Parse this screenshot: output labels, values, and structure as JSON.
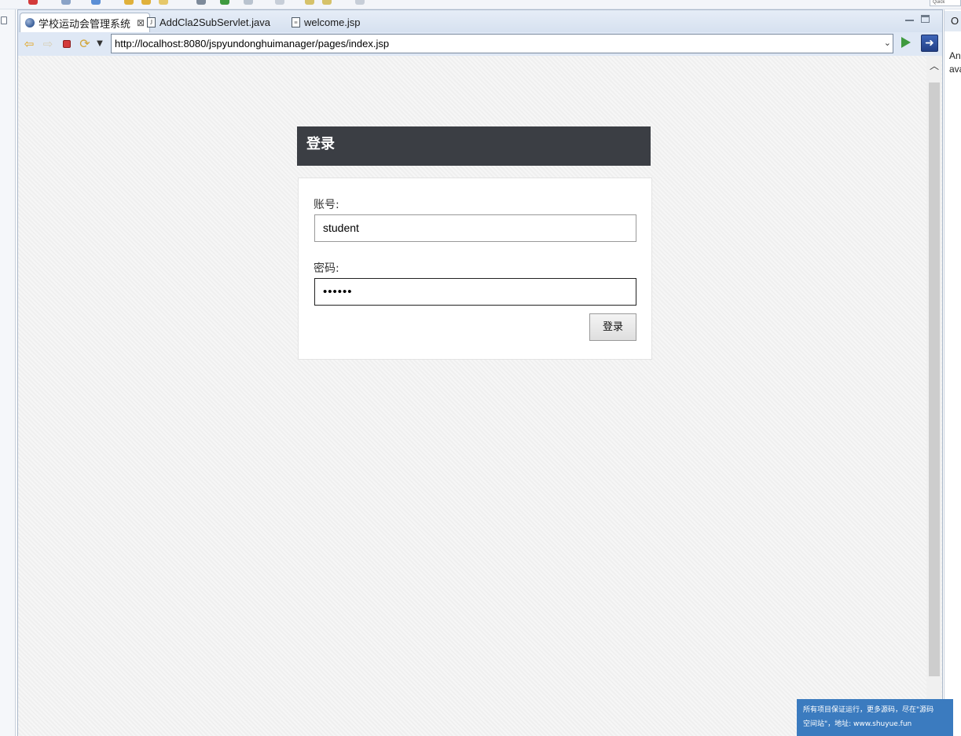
{
  "top_toolbar": {
    "quick_access_text": "Quick"
  },
  "tabs": [
    {
      "label": "学校运动会管理系统",
      "icon": "globe-icon",
      "active": true,
      "close": "⊠"
    },
    {
      "label": "AddCla2SubServlet.java",
      "icon": "java-file-icon",
      "active": false
    },
    {
      "label": "welcome.jsp",
      "icon": "jsp-file-icon",
      "active": false
    }
  ],
  "browser": {
    "url": "http://localhost:8080/jspyundonghuimanager/pages/index.jsp",
    "icons": {
      "back": "back-arrow-icon",
      "forward": "forward-arrow-icon",
      "stop": "stop-icon",
      "refresh": "refresh-icon",
      "go": "go-icon",
      "external": "open-external-icon"
    }
  },
  "login": {
    "title": "登录",
    "username_label": "账号:",
    "username_value": "student",
    "password_label": "密码:",
    "password_value": "••••••",
    "submit_label": "登录"
  },
  "watermark": {
    "line1": "所有项目保证运行，更多源码，尽在\"源码",
    "line2": "空间站\"，地址: www.shuyue.fun"
  },
  "right_panel": {
    "tab_label": "O",
    "text_line1": "An",
    "text_line2": "ava"
  },
  "colors": {
    "login_header_bg": "#3b3e44",
    "page_bg": "#f2f2f2",
    "watermark_bg": "#3b7bbf",
    "stop_red": "#d33a3a",
    "go_green": "#3f9a3f"
  }
}
